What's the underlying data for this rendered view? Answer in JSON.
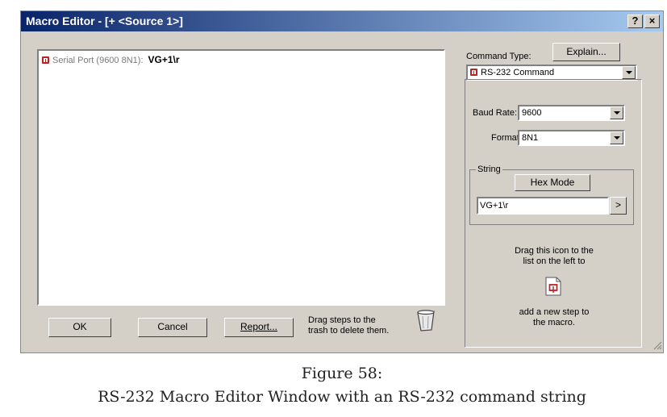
{
  "window": {
    "title": "Macro Editor - [+ <Source 1>]",
    "help_btn": "?",
    "close_btn": "×"
  },
  "macro_list": {
    "items": [
      {
        "port": "Serial Port (9600 8N1):",
        "command": "VG+1\\r",
        "icon": "serial-port-icon"
      }
    ]
  },
  "footer": {
    "ok_label": "OK",
    "cancel_label": "Cancel",
    "report_label": "Report...",
    "trash_hint": "Drag steps to the trash to delete them.",
    "trash_hint_line1": "Drag steps to the",
    "trash_hint_line2": "trash to delete them."
  },
  "command_panel": {
    "command_type_label": "Command Type:",
    "explain_label": "Explain...",
    "command_type_value": "RS-232 Command",
    "baud_rate_label": "Baud Rate:",
    "baud_rate_value": "9600",
    "format_label": "Format:",
    "format_value": "8N1",
    "string_group_label": "String",
    "hex_mode_label": "Hex Mode",
    "string_value": "VG+1\\r",
    "send_label": ">",
    "drag_hint_line1": "Drag this icon to the",
    "drag_hint_line2": "list on the left to",
    "add_hint_line1": "add a new step to",
    "add_hint_line2": "the macro."
  },
  "caption": {
    "line1": "Figure 58:",
    "line2": "RS-232 Macro Editor Window with an RS-232 command string"
  },
  "colors": {
    "title_gradient_start": "#0a246a",
    "title_gradient_end": "#a6caf0",
    "dialog_face": "#d4d0c8",
    "serial_icon": "#b22222"
  }
}
